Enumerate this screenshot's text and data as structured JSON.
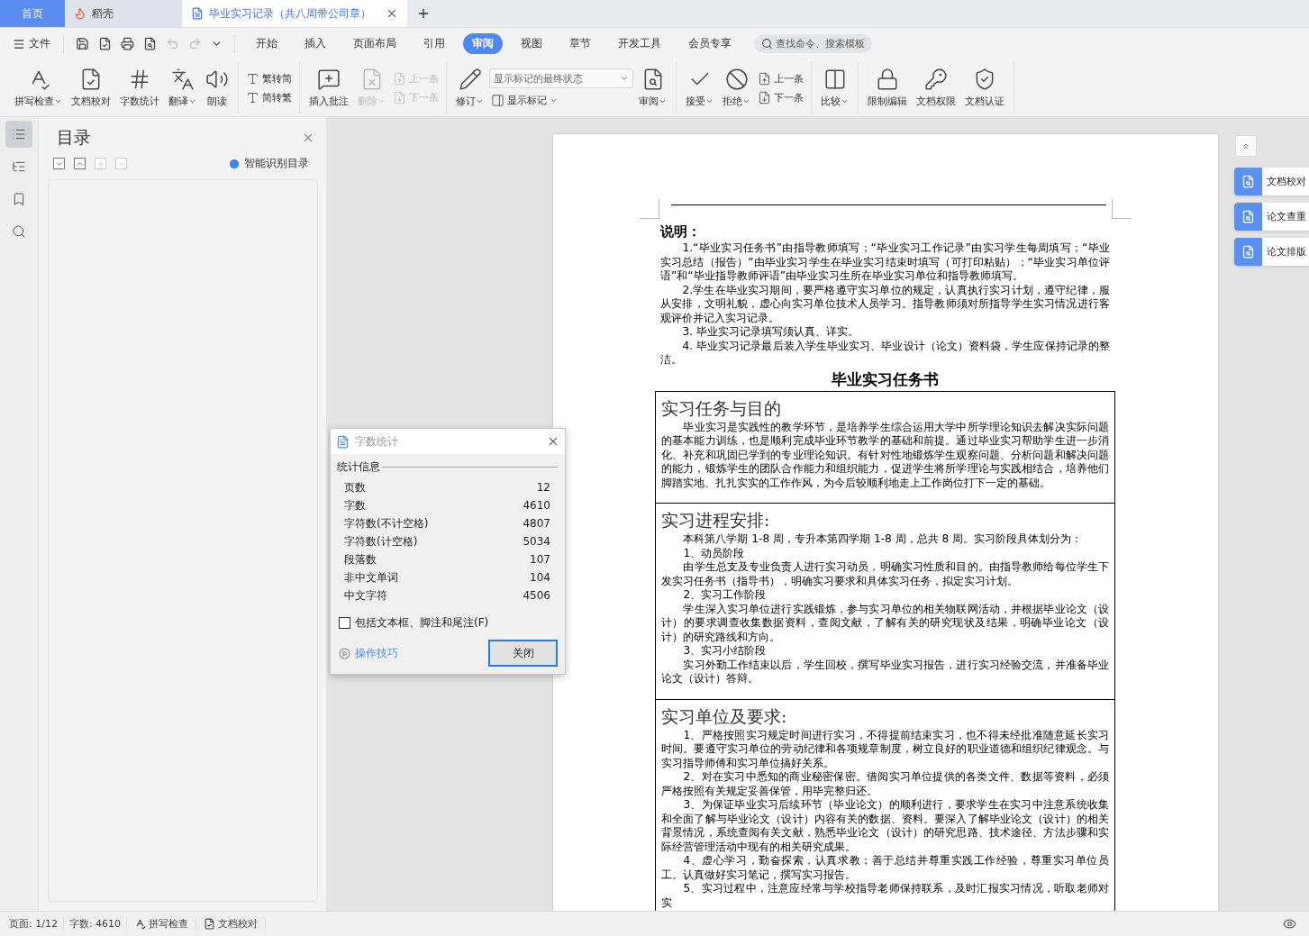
{
  "tabs": [
    {
      "label": "首页",
      "kind": "home",
      "selected": false
    },
    {
      "label": "稻壳",
      "kind": "app",
      "selected": false
    },
    {
      "label": "毕业实习记录（共八周带公司章）",
      "kind": "doc",
      "selected": true
    }
  ],
  "menu": {
    "file": "文件",
    "ribbon_tabs": [
      {
        "label": "开始",
        "selected": false
      },
      {
        "label": "插入",
        "selected": false
      },
      {
        "label": "页面布局",
        "selected": false
      },
      {
        "label": "引用",
        "selected": false
      },
      {
        "label": "审阅",
        "selected": true
      },
      {
        "label": "视图",
        "selected": false
      },
      {
        "label": "章节",
        "selected": false
      },
      {
        "label": "开发工具",
        "selected": false
      },
      {
        "label": "会员专享",
        "selected": false
      }
    ],
    "search": {
      "placeholder": "查找命令、搜索模板"
    }
  },
  "ribbon": [
    [
      {
        "kind": "spell",
        "label": "拼写检查",
        "dropdown": true,
        "disabled": false
      },
      {
        "kind": "proof",
        "label": "文档校对",
        "dropdown": false,
        "disabled": false
      },
      {
        "kind": "count",
        "label": "字数统计",
        "dropdown": false,
        "disabled": false
      },
      {
        "kind": "translate",
        "label": "翻译",
        "dropdown": true,
        "disabled": false
      },
      {
        "kind": "read",
        "label": "朗读",
        "dropdown": false,
        "disabled": false
      }
    ],
    [
      {
        "kind": "stack",
        "items": [
          {
            "kind": "simp",
            "label": "繁转简",
            "dropdown": false,
            "disabled": false
          },
          {
            "kind": "trad",
            "label": "简转繁",
            "dropdown": false,
            "disabled": false
          }
        ]
      }
    ],
    [
      {
        "kind": "comment",
        "label": "插入批注",
        "dropdown": false,
        "disabled": false
      },
      {
        "kind": "delete",
        "label": "删除",
        "dropdown": true,
        "disabled": true
      },
      {
        "kind": "stack",
        "items": [
          {
            "kind": "prev",
            "label": "上一条",
            "dropdown": false,
            "disabled": true
          },
          {
            "kind": "next",
            "label": "下一条",
            "dropdown": false,
            "disabled": true
          }
        ]
      }
    ],
    [
      {
        "kind": "track",
        "label": "修订",
        "dropdown": true,
        "disabled": false
      },
      {
        "kind": "stack",
        "items": [
          {
            "kind": "select",
            "label": "显示标记的最终状态"
          },
          {
            "kind": "markup",
            "label": "显示标记",
            "dropdown": true,
            "disabled": false
          }
        ]
      },
      {
        "kind": "pane",
        "label": "审阅",
        "dropdown": true,
        "disabled": false
      }
    ],
    [
      {
        "kind": "accept",
        "label": "接受",
        "dropdown": true,
        "disabled": false
      },
      {
        "kind": "reject",
        "label": "拒绝",
        "dropdown": true,
        "disabled": false
      },
      {
        "kind": "stack",
        "items": [
          {
            "kind": "prev",
            "label": "上一条",
            "dropdown": false,
            "disabled": false
          },
          {
            "kind": "next",
            "label": "下一条",
            "dropdown": false,
            "disabled": false
          }
        ]
      }
    ],
    [
      {
        "kind": "compare",
        "label": "比较",
        "dropdown": true,
        "disabled": false
      }
    ],
    [
      {
        "kind": "lock",
        "label": "限制编辑",
        "dropdown": false,
        "disabled": false
      },
      {
        "kind": "permission",
        "label": "文档权限",
        "dropdown": false,
        "disabled": false
      },
      {
        "kind": "certify",
        "label": "文档认证",
        "dropdown": false,
        "disabled": false
      }
    ]
  ],
  "rail": [
    {
      "kind": "outline",
      "selected": true
    },
    {
      "kind": "structure",
      "selected": false
    },
    {
      "kind": "bookmark",
      "selected": false
    },
    {
      "kind": "search",
      "selected": false
    }
  ],
  "toc": {
    "title": "目录",
    "tools": [
      {
        "kind": "down",
        "disabled": false
      },
      {
        "kind": "up",
        "disabled": false
      },
      {
        "kind": "plus",
        "disabled": true
      },
      {
        "kind": "minus",
        "disabled": true
      }
    ],
    "smart": "智能识别目录"
  },
  "document": {
    "notes_title": "说明：",
    "notes": [
      "1.“毕业实习任务书”由指导教师填写；“毕业实习工作记录”由实习学生每周填写；“毕业实习总结（报告）”由毕业实习学生在毕业实习结束时填写（可打印粘贴）；“毕业实习单位评语”和“毕业指导教师评语”由毕业实习生所在毕业实习单位和指导教师填写。",
      "2.学生在毕业实习期间，要严格遵守实习单位的规定，认真执行实习计划，遵守纪律，服从安排，文明礼貌，虚心向实习单位技术人员学习。指导教师须对所指导学生实习情况进行客观评价并记入实习记录。",
      "3.  毕业实习记录填写须认真、详实。",
      "4.  毕业实习记录最后装入学生毕业实习、毕业设计（论文）资料袋，学生应保持记录的整洁。"
    ],
    "title": "毕业实习任务书",
    "sections": [
      {
        "heading": "实习任务与目的",
        "paragraphs": [
          "毕业实习是实践性的教学环节，是培养学生综合运用大学中所学理论知识去解决实际问题的基本能力训练，也是顺利完成毕业环节教学的基础和前提。通过毕业实习帮助学生进一步消化、补充和巩固已学到的专业理论知识。有针对性地锻炼学生观察问题、分析问题和解决问题的能力，锻炼学生的团队合作能力和组织能力，促进学生将所学理论与实践相结合，培养他们脚踏实地、扎扎实实的工作作风，为今后较顺利地走上工作岗位打下一定的基础。"
        ]
      },
      {
        "heading": "实习进程安排:",
        "paragraphs": [
          "本科第八学期 1-8 周，专升本第四学期 1-8 周，总共 8 周。实习阶段具体划分为：",
          "1、动员阶段",
          "由学生总支及专业负责人进行实习动员，明确实习性质和目的。由指导教师给每位学生下发实习任务书（指导书），明确实习要求和具体实习任务，拟定实习计划。",
          "2、实习工作阶段",
          "学生深入实习单位进行实践锻炼，参与实习单位的相关物联网活动，并根据毕业论文（设计）的要求调查收集数据资料，查阅文献，了解有关的研究现状及结果，明确毕业论文（设计）的研究路线和方向。",
          "3、实习小结阶段",
          "实习外勤工作结束以后，学生回校，撰写毕业实习报告，进行实习经验交流，并准备毕业论文（设计）答辩。"
        ]
      },
      {
        "heading": "实习单位及要求:",
        "paragraphs": [
          "1、严格按照实习规定时间进行实习，不得提前结束实习，也不得未经批准随意延长实习时间。要遵守实习单位的劳动纪律和各项规章制度，树立良好的职业道德和组织纪律观念。与实习指导师傅和实习单位搞好关系。",
          "2、对在实习中悉知的商业秘密保密。借阅实习单位提供的各类文件、数据等资料，必须严格按照有关规定妥善保管，用毕完整归还。",
          "3、为保证毕业实习后续环节（毕业论文）的顺利进行，要求学生在实习中注意系统收集和全面了解与毕业论文（设计）内容有关的数据、资料。要深入了解毕业论文（设计）的相关背景情况，系统查阅有关文献，熟悉毕业论文（设计）的研究思路、技术途径、方法步骤和实际经营管理活动中现有的相关研究成果。",
          "4、虚心学习，勤奋探索，认真求教；善于总结并尊重实践工作经验，尊重实习单位员工。认真做好实习笔记，撰写实习报告。",
          "5、实习过程中，注意应经常与学校指导老师保持联系，及时汇报实习情况，听取老师对实"
        ]
      }
    ]
  },
  "dialog": {
    "title": "字数统计",
    "group": "统计信息",
    "stats": [
      {
        "label": "页数",
        "value": "12"
      },
      {
        "label": "字数",
        "value": "4610"
      },
      {
        "label": "字符数(不计空格)",
        "value": "4807"
      },
      {
        "label": "字符数(计空格)",
        "value": "5034"
      },
      {
        "label": "段落数",
        "value": "107"
      },
      {
        "label": "非中文单词",
        "value": "104"
      },
      {
        "label": "中文字符",
        "value": "4506"
      }
    ],
    "checkbox": {
      "label": "包括文本框、脚注和尾注(F)",
      "checked": false
    },
    "link": "操作技巧",
    "button": "关闭"
  },
  "side_buttons": [
    "文档校对",
    "论文查重",
    "论文排版"
  ],
  "status_bar": {
    "page": "页面: 1/12",
    "words": "字数: 4610",
    "spell": "拼写检查",
    "proof": "文档校对"
  }
}
